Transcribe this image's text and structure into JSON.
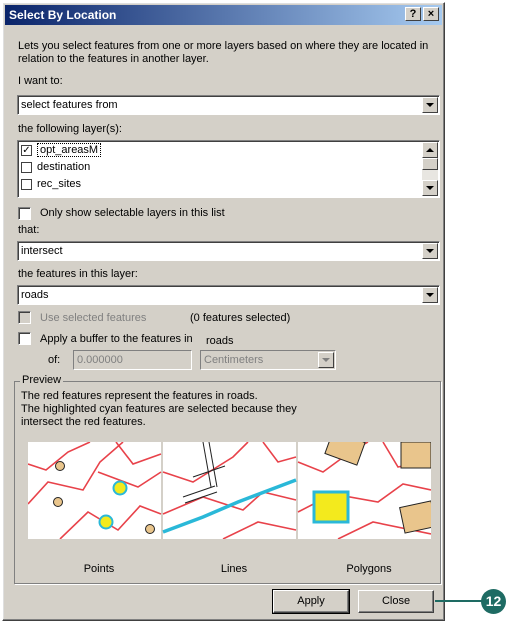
{
  "dialog": {
    "title": "Select By Location",
    "help_glyph": "?",
    "close_glyph": "×",
    "description": "Lets you select features from one or more layers based on where they are located in relation to the features in another layer."
  },
  "method": {
    "label": "I want to:",
    "value": "select features from"
  },
  "layers": {
    "label": "the following layer(s):",
    "items": [
      {
        "name": "opt_areasM",
        "checked": true,
        "mark": "✓"
      },
      {
        "name": "destination",
        "checked": false,
        "mark": ""
      },
      {
        "name": "rec_sites",
        "checked": false,
        "mark": ""
      }
    ],
    "only_selectable_label": "Only show selectable layers in this list"
  },
  "relation": {
    "label": "that:",
    "value": "intersect"
  },
  "source_layer": {
    "label": "the features in this layer:",
    "value": "roads"
  },
  "use_selected": {
    "label": "Use selected features",
    "count_text": "(0 features selected)"
  },
  "buffer": {
    "label": "Apply a buffer to the features in",
    "layer_name": "roads",
    "of_label": "of:",
    "distance": "0.000000",
    "units": "Centimeters"
  },
  "preview": {
    "label": "Preview",
    "line1": "The red features represent the features in roads.",
    "line2": "The highlighted cyan features are selected because they",
    "line3": "intersect the red features.",
    "captions": [
      "Points",
      "Lines",
      "Polygons"
    ]
  },
  "buttons": {
    "apply": "Apply",
    "close": "Close"
  },
  "callout": {
    "number": "12",
    "color": "#1e6b63"
  },
  "colors": {
    "titlebar_start": "#0a246a",
    "roads_red": "#e8424a",
    "selected_cyan": "#2ab8d8",
    "feature_tan": "#e9c58c",
    "highlight_yellow": "#f3ea1d"
  }
}
